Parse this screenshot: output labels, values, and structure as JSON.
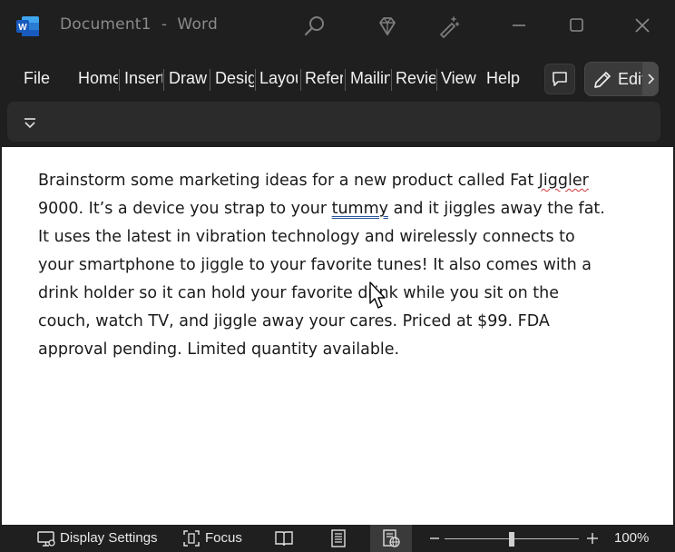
{
  "window": {
    "title": "Document1  -  Word",
    "app_icon": "word-icon"
  },
  "titlebar_icons": [
    "search-icon",
    "diamond-icon",
    "magic-wand-icon"
  ],
  "window_controls": [
    "minimize-icon",
    "maximize-icon",
    "close-icon"
  ],
  "tabs": [
    {
      "label": "File"
    },
    {
      "label": "Home"
    },
    {
      "label": "Insert"
    },
    {
      "label": "Draw"
    },
    {
      "label": "Design"
    },
    {
      "label": "Layout"
    },
    {
      "label": "References"
    },
    {
      "label": "Mailings"
    },
    {
      "label": "Review"
    },
    {
      "label": "View"
    },
    {
      "label": "Help"
    }
  ],
  "edit_button": {
    "label": "Editing",
    "icon": "pencil-icon"
  },
  "comment_button": {
    "icon": "comment-icon"
  },
  "ribbon": {
    "toggle_icon": "ribbon-expand-icon"
  },
  "document": {
    "lines": [
      {
        "parts": [
          "Brainstorm some marketing ideas for a new product called Fat ",
          "Jiggler",
          ""
        ]
      },
      {
        "parts": [
          "9000. It’s a device you strap to your ",
          "tummy",
          " and it jiggles away the fat."
        ]
      },
      {
        "parts": [
          "It uses the latest in vibration technology and wirelessly connects to",
          "",
          ""
        ]
      },
      {
        "parts": [
          "your smartphone to jiggle to your favorite tunes! It also comes with a",
          "",
          ""
        ]
      },
      {
        "parts": [
          "drink holder so it can hold your favorite drink while you sit on the",
          "",
          ""
        ]
      },
      {
        "parts": [
          "couch, watch TV, and jiggle away your cares. Priced at $99. FDA",
          "",
          ""
        ]
      },
      {
        "parts": [
          "approval pending. Limited quantity available.",
          "",
          ""
        ]
      }
    ]
  },
  "statusbar": {
    "display_settings": "Display Settings",
    "focus": "Focus",
    "zoom": "100%",
    "zoom_level_percent": 100,
    "icons": [
      "display-settings-icon",
      "focus-icon",
      "read-mode-icon",
      "print-layout-icon",
      "web-layout-icon"
    ]
  }
}
